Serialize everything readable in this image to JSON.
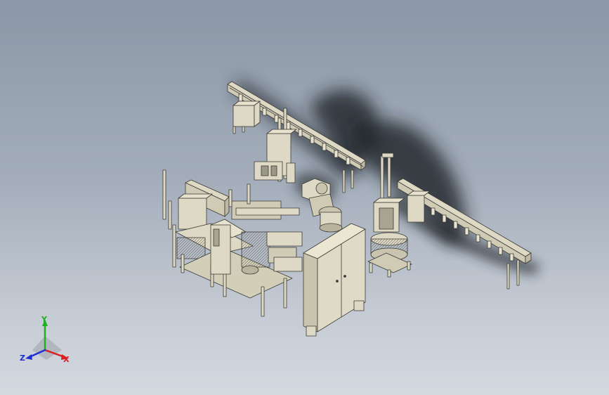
{
  "viewport": {
    "background_top": "#8c97a7",
    "background_bottom": "#d4d8df"
  },
  "model": {
    "part_fill": "#ddd9c4",
    "part_stroke": "#3a3a36",
    "shadow_color": "#1e2226"
  },
  "triad": {
    "x_label": "X",
    "y_label": "Y",
    "z_label": "Z",
    "x_color": "#d82020",
    "y_color": "#22b022",
    "z_color": "#2030d0"
  }
}
